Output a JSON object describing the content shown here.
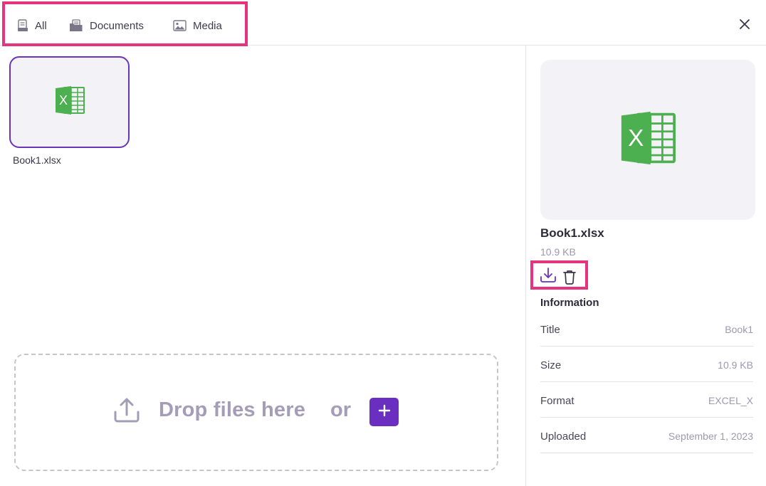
{
  "tabs": [
    {
      "label": "All",
      "icon": "file-icon"
    },
    {
      "label": "Documents",
      "icon": "folder-icon"
    },
    {
      "label": "Media",
      "icon": "image-icon"
    }
  ],
  "close_icon": "close-icon",
  "files": [
    {
      "name": "Book1.xlsx",
      "icon": "excel-icon"
    }
  ],
  "dropzone": {
    "text": "Drop files here",
    "or": "or",
    "add_label": "+"
  },
  "details": {
    "name": "Book1.xlsx",
    "size": "10.9 KB",
    "actions": [
      "download-icon",
      "trash-icon"
    ],
    "info_heading": "Information",
    "info": [
      {
        "key": "Title",
        "value": "Book1"
      },
      {
        "key": "Size",
        "value": "10.9 KB"
      },
      {
        "key": "Format",
        "value": "EXCEL_X"
      },
      {
        "key": "Uploaded",
        "value": "September 1, 2023"
      }
    ]
  },
  "colors": {
    "accent": "#6a2fc0",
    "highlight": "#e5337f",
    "excel_green": "#4caf50",
    "muted_text": "#9e98b0"
  }
}
